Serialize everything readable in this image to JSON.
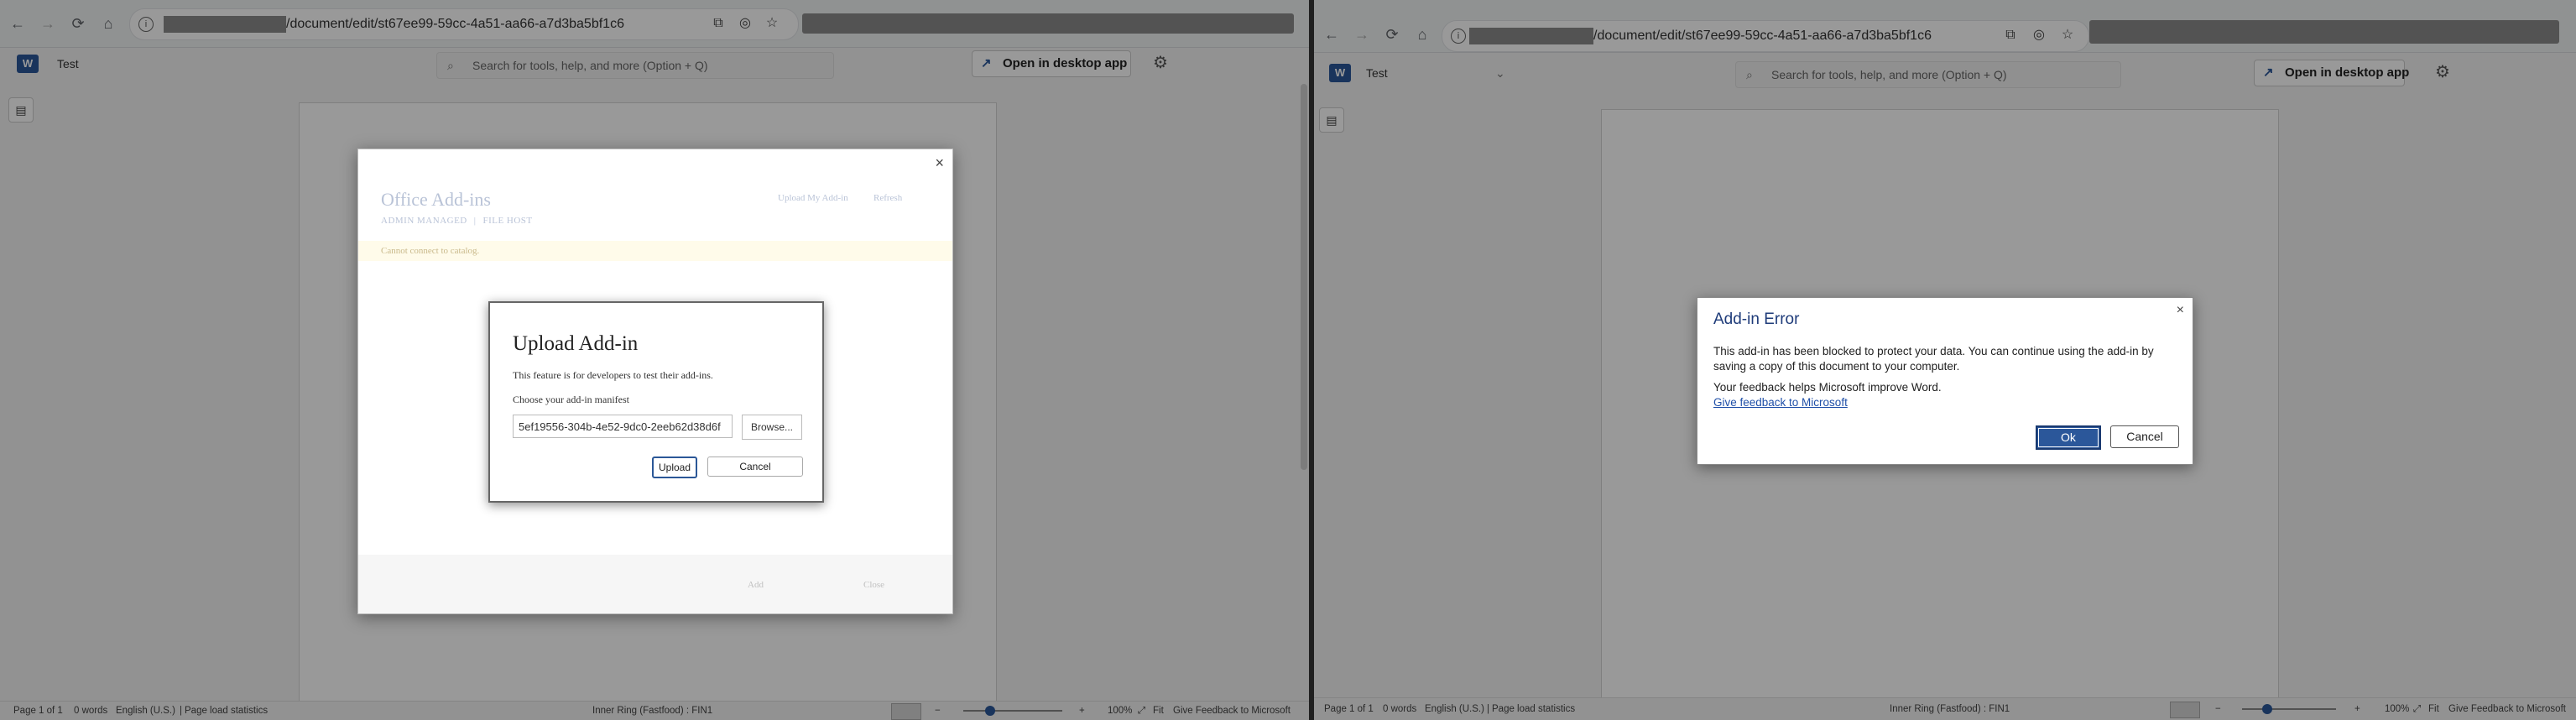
{
  "left": {
    "browser": {
      "url_path": "/document/edit/st67ee99-59cc-4a51-aa66-a7d3ba5bf1c6"
    },
    "app": {
      "doc_title": "Test",
      "search_placeholder": "Search for tools, help, and more (Option + Q)",
      "open_desktop_label": "Open in desktop app"
    },
    "addins_modal": {
      "title": "Office Add-ins",
      "tab_admin": "ADMIN MANAGED",
      "tab_separator": "|",
      "tab_file": "FILE HOST",
      "upload_link": "Upload My Add-in",
      "refresh": "Refresh",
      "warning": "Cannot connect to catalog.",
      "footer_add": "Add",
      "footer_close": "Close"
    },
    "upload_dialog": {
      "title": "Upload Add-in",
      "description": "This feature is for developers to test their add-ins.",
      "choose_label": "Choose your add-in manifest",
      "file_value": "5ef19556-304b-4e52-9dc0-2eeb62d38d6f",
      "browse_label": "Browse...",
      "upload_label": "Upload",
      "cancel_label": "Cancel"
    },
    "status": {
      "page": "Page 1 of 1",
      "words": "0 words",
      "language": "English (U.S.)",
      "sep": "|",
      "load_stats": "Page load statistics",
      "ring": "Inner Ring (Fastfood) : FIN1",
      "zoom_minus": "−",
      "zoom_plus": "+",
      "zoom": "100%",
      "fit": "Fit",
      "feedback": "Give Feedback to Microsoft"
    }
  },
  "right": {
    "browser": {
      "url_path": "/document/edit/st67ee99-59cc-4a51-aa66-a7d3ba5bf1c6"
    },
    "app": {
      "doc_title": "Test",
      "search_placeholder": "Search for tools, help, and more (Option + Q)",
      "open_desktop_label": "Open in desktop app"
    },
    "error_dialog": {
      "title": "Add-in Error",
      "message": "This add-in has been blocked to protect your data. You can continue using the add-in by saving a copy of this document to your computer.",
      "feedback_text": "Your feedback helps Microsoft improve Word.",
      "feedback_link": "Give feedback to Microsoft",
      "ok_label": "Ok",
      "cancel_label": "Cancel"
    },
    "status": {
      "page": "Page 1 of 1",
      "words": "0 words",
      "language": "English (U.S.)",
      "sep": "|",
      "load_stats": "Page load statistics",
      "ring": "Inner Ring (Fastfood) : FIN1",
      "zoom_minus": "−",
      "zoom_plus": "+",
      "zoom": "100%",
      "fit": "Fit",
      "feedback": "Give Feedback to Microsoft"
    }
  },
  "icons": {
    "back": "←",
    "forward": "→",
    "reload": "⟳",
    "home": "⌂",
    "info": "i",
    "cast": "⧉",
    "eye_off": "◎",
    "star": "☆",
    "search": "⌕",
    "open_external": "↗",
    "gear": "⚙",
    "sidebar": "▤",
    "close": "×",
    "chevron": "⌄",
    "refresh": "⟳",
    "fit": "⤢"
  },
  "colors": {
    "word_blue": "#2b579a",
    "link_blue": "#1f4fa8",
    "overlay": "rgba(0,0,0,0.4)"
  }
}
